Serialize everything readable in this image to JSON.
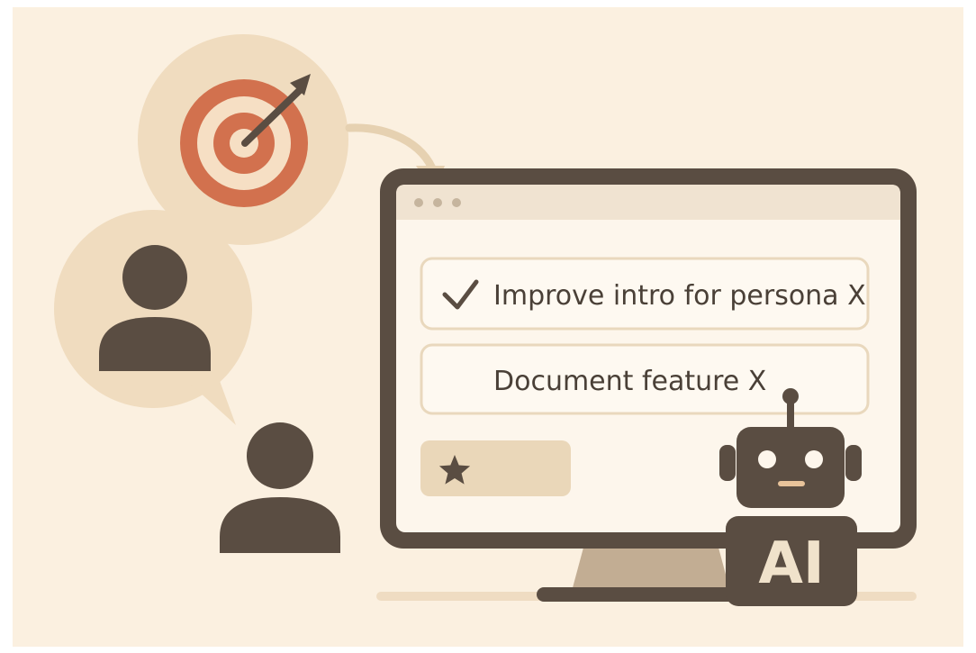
{
  "tasks": [
    {
      "label": "Improve intro for persona X",
      "checked": true,
      "icon": "check-icon"
    },
    {
      "label": "Document feature X",
      "checked": false,
      "icon": null
    }
  ],
  "badge": {
    "label": "AI"
  },
  "icons": {
    "goal": "target-icon",
    "arrow": "curved-arrow-icon",
    "user": "person-icon",
    "favorite": "star-icon",
    "assistant": "robot-icon"
  },
  "colors": {
    "background": "#fbf0e0",
    "bubble": "#f0dcbf",
    "dark": "#5a4d42",
    "target_red": "#d2714e",
    "screen": "#fdf6ec",
    "titlebar": "#f0e3d1",
    "star_button": "#ead7b9",
    "ai_text": "#f0e2cb"
  }
}
